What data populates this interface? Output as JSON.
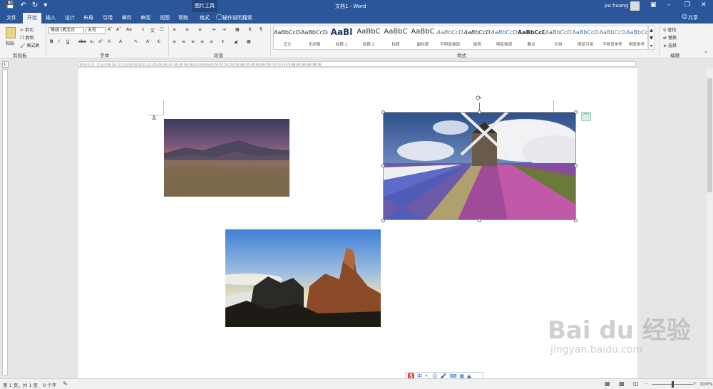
{
  "titlebar": {
    "context_tab": "图片工具",
    "document_title": "文档1 - Word",
    "user_name": "pu huang"
  },
  "tabs": [
    {
      "label": "文件"
    },
    {
      "label": "开始"
    },
    {
      "label": "插入"
    },
    {
      "label": "设计"
    },
    {
      "label": "布局"
    },
    {
      "label": "引用"
    },
    {
      "label": "邮件"
    },
    {
      "label": "审阅"
    },
    {
      "label": "视图"
    },
    {
      "label": "帮助"
    },
    {
      "label": "格式"
    }
  ],
  "tell_me": "操作说明搜索",
  "share": "共享",
  "ribbon": {
    "clipboard": {
      "paste": "粘贴",
      "cut": "剪切",
      "copy": "复制",
      "format_painter": "格式刷",
      "label": "剪贴板"
    },
    "font": {
      "name": "等线 (西文正",
      "size": "五号",
      "label": "字体"
    },
    "paragraph": {
      "label": "段落"
    },
    "styles": {
      "label": "样式",
      "items": [
        {
          "sample": "AaBbCcDd",
          "name": "正文"
        },
        {
          "sample": "AaBbCcDd",
          "name": "无间隔"
        },
        {
          "sample": "AaBl",
          "name": "标题 1"
        },
        {
          "sample": "AaBbC",
          "name": "标题 2"
        },
        {
          "sample": "AaBbC",
          "name": "标题"
        },
        {
          "sample": "AaBbC",
          "name": "副标题"
        },
        {
          "sample": "AaBbCcD",
          "name": "不明显强调"
        },
        {
          "sample": "AaBbCcD",
          "name": "强调"
        },
        {
          "sample": "AaBbCcD",
          "name": "明显强调"
        },
        {
          "sample": "AaBbCcD",
          "name": "要点"
        },
        {
          "sample": "AaBbCcD",
          "name": "引用"
        },
        {
          "sample": "AaBbCcD",
          "name": "明显引用"
        },
        {
          "sample": "AaBbCcD",
          "name": "不明显参考"
        },
        {
          "sample": "AaBbCcD",
          "name": "明显参考"
        }
      ]
    },
    "editing": {
      "find": "查找",
      "replace": "替换",
      "select": "选择",
      "label": "编辑"
    }
  },
  "ruler_text": "|8|6|4|2| |2|4|6|8|10|12|14|16|18|20|22|24|26|28|30|32|34|36|38|40|42|44|46|48|50|52|54|56|58|60|62|64|66|68|70|72|74|76|78|80|82|84|86|88|90",
  "status": {
    "page": "第 1 页，共 1 页",
    "words": "0 个字",
    "zoom": "100%"
  },
  "ime_label": "中",
  "watermark": {
    "line1": "Bai du 经验",
    "line2": "jingyan.baidu.com"
  },
  "colors": {
    "brand": "#2b579a",
    "page": "#ffffff",
    "canvas": "#e6e6e6"
  }
}
